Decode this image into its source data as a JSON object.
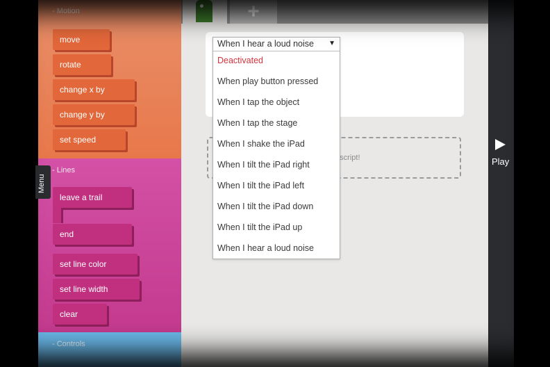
{
  "palette": {
    "motion": {
      "header": "- Motion",
      "blocks": [
        "move",
        "rotate",
        "change x by",
        "change y by",
        "set speed"
      ]
    },
    "lines": {
      "header": "- Lines",
      "blocks": [
        "leave a trail",
        "end",
        "set line color",
        "set line width",
        "clear"
      ]
    },
    "controls": {
      "header": "- Controls"
    },
    "colors": {
      "motion": "#e8784a",
      "lines": "#c33a8e",
      "controls": "#6ab8e8"
    }
  },
  "menu_tab": {
    "label": "Menu"
  },
  "toolbar": {
    "add_label": "+"
  },
  "dropdown": {
    "selected": "When I hear a loud noise",
    "options": [
      "Deactivated",
      "When play button pressed",
      "When I tap the object",
      "When I tap the stage",
      "When I shake the iPad",
      "When I tilt the iPad right",
      "When I tilt the iPad left",
      "When I tilt the iPad down",
      "When I tilt the iPad up",
      "When I hear a loud noise"
    ]
  },
  "drop_zone": {
    "text": "e script!"
  },
  "play": {
    "label": "Play"
  }
}
